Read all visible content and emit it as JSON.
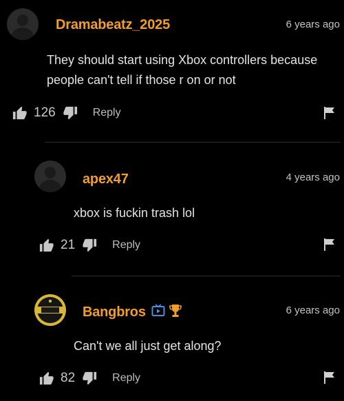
{
  "comments": [
    {
      "username": "Dramabeatz_2025",
      "timestamp": "6 years ago",
      "text": "They should start using Xbox controllers because people can't tell if those r on or not",
      "likes": "126",
      "reply_label": "Reply",
      "avatar": "default-user-icon"
    },
    {
      "username": "apex47",
      "timestamp": "4 years ago",
      "text": "xbox is fuckin trash lol",
      "likes": "21",
      "reply_label": "Reply",
      "avatar": "default-user-icon"
    },
    {
      "username": "Bangbros",
      "timestamp": "6 years ago",
      "text": "Can't we all just get along?",
      "likes": "82",
      "reply_label": "Reply",
      "avatar": "channel-logo",
      "badges": [
        "video-channel-icon",
        "trophy-icon"
      ]
    }
  ],
  "colors": {
    "background": "#000000",
    "username": "#f29e2b",
    "text": "#e4e4e4",
    "muted": "#c4c4c4",
    "badge": "#4a90e2",
    "trophy": "#f29e2b"
  }
}
